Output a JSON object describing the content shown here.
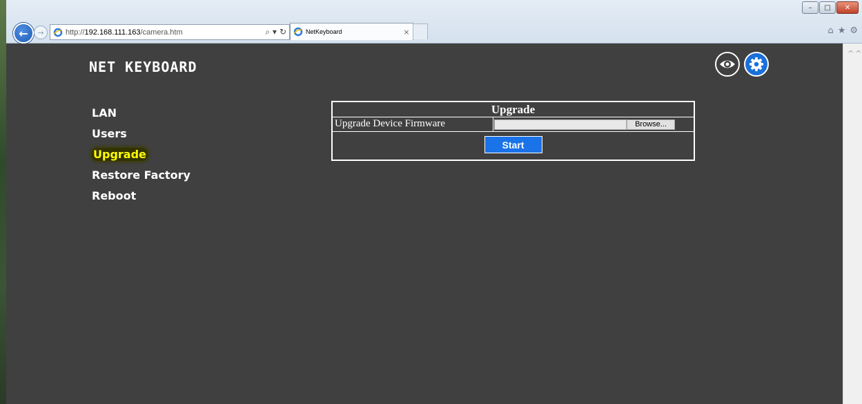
{
  "browser": {
    "address_prefix": "http://",
    "address_host": "192.168.111.163",
    "address_path": "/camera.htm",
    "tab_title": "NetKeyboard",
    "tab_close": "×",
    "back_glyph": "←",
    "forward_glyph": "→",
    "search_glyph": "⌕ ▾",
    "refresh_glyph": "↻",
    "window_buttons": {
      "minimize": "–",
      "maximize": "□",
      "close": "✕"
    },
    "right_tools": {
      "home": "⌂",
      "favorites": "★",
      "settings": "⚙"
    },
    "scroll_glyph": "^^"
  },
  "header": {
    "brand": "NET KEYBOARD",
    "icons": [
      "eye-icon",
      "gear-icon"
    ]
  },
  "sidebar": {
    "items": [
      {
        "label": "LAN"
      },
      {
        "label": "Users"
      },
      {
        "label": "Upgrade",
        "active": true
      },
      {
        "label": "Restore Factory"
      },
      {
        "label": "Reboot"
      }
    ]
  },
  "upgrade_panel": {
    "title": "Upgrade",
    "firmware_label": "Upgrade Device Firmware",
    "file_value": "",
    "browse_label": "Browse...",
    "start_label": "Start"
  },
  "colors": {
    "page_background": "#404040",
    "active_nav": "#ffff00",
    "accent": "#1a73e8"
  }
}
